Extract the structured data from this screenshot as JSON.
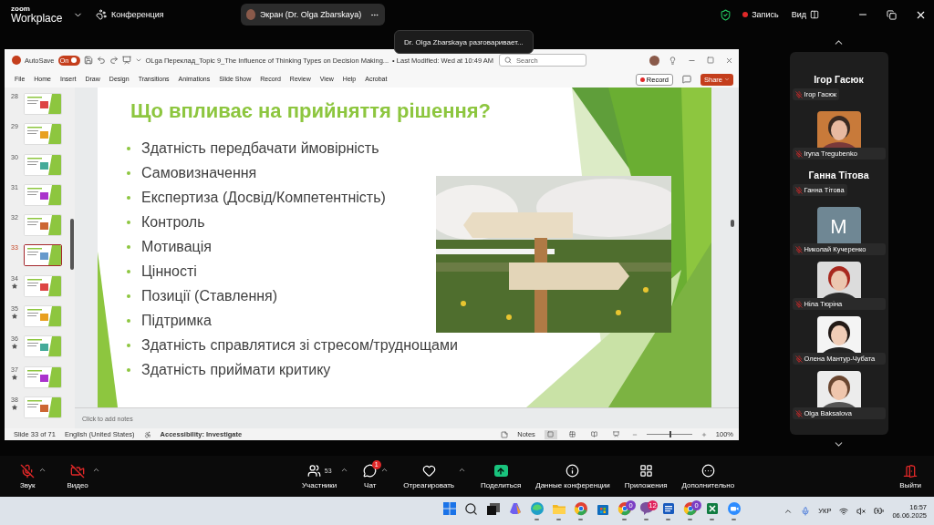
{
  "zoom_header": {
    "brand_top": "zoom",
    "brand_bottom": "Workplace",
    "meeting_label": "Конференция",
    "share_pill": "Экран (Dr. Olga Zbarskaya)",
    "recording": true,
    "record_label": "Запись",
    "view_label": "Вид"
  },
  "speaker_tooltip": "Dr. Olga Zbarskaya разговаривает...",
  "powerpoint": {
    "autosave_label": "AutoSave",
    "autosave_on": true,
    "autosave_state": "On",
    "file_title": "OLga Переклад_Topic 9_The Influence of Thinking Types on Decision Making...",
    "last_modified": "• Last Modified: Wed at 10:49 AM",
    "search_placeholder": "Search",
    "tabs": [
      {
        "label": "File",
        "selected": false
      },
      {
        "label": "Home",
        "selected": false
      },
      {
        "label": "Insert",
        "selected": false
      },
      {
        "label": "Draw",
        "selected": false
      },
      {
        "label": "Design",
        "selected": false
      },
      {
        "label": "Transitions",
        "selected": false
      },
      {
        "label": "Animations",
        "selected": false
      },
      {
        "label": "Slide Show",
        "selected": false
      },
      {
        "label": "Record",
        "selected": false
      },
      {
        "label": "Review",
        "selected": false
      },
      {
        "label": "View",
        "selected": false
      },
      {
        "label": "Help",
        "selected": false
      },
      {
        "label": "Acrobat",
        "selected": false
      }
    ],
    "record_button": "Record",
    "share_button": "Share",
    "thumbnails": [
      {
        "number": "28",
        "starred": false,
        "selected": false
      },
      {
        "number": "29",
        "starred": false,
        "selected": false
      },
      {
        "number": "30",
        "starred": false,
        "selected": false
      },
      {
        "number": "31",
        "starred": false,
        "selected": false
      },
      {
        "number": "32",
        "starred": false,
        "selected": false
      },
      {
        "number": "33",
        "starred": false,
        "selected": true
      },
      {
        "number": "34",
        "starred": true,
        "selected": false
      },
      {
        "number": "35",
        "starred": true,
        "selected": false
      },
      {
        "number": "36",
        "starred": true,
        "selected": false
      },
      {
        "number": "37",
        "starred": true,
        "selected": false
      },
      {
        "number": "38",
        "starred": true,
        "selected": false
      }
    ],
    "slide": {
      "title": "Що впливає на прийняття рішення?",
      "bullets": [
        "Здатність передбачати ймовірність",
        "Самовизначення",
        "Експертиза (Досвід/Компетентність)",
        "Контроль",
        "Мотивація",
        "Цінності",
        "Позиції (Ставлення)",
        "Підтримка",
        "Здатність справлятися зі стресом/труднощами",
        "Здатність приймати критику"
      ],
      "picture": {
        "kind": "picture"
      }
    },
    "notes_placeholder": "Click to add notes",
    "status_bar": {
      "slide_info": "Slide 33 of 71",
      "language": "English (United States)",
      "accessibility": "Accessibility: Investigate",
      "notes_label": "Notes",
      "views": [
        {
          "selected": true
        },
        {
          "selected": false
        },
        {
          "selected": false
        },
        {
          "selected": false
        }
      ],
      "zoom_slider": {
        "level": 0.5
      },
      "zoom_percent": "100%"
    }
  },
  "participants": [
    {
      "kind": "name_tile",
      "heading": "Ігор Гасюк",
      "name": "Ігор Гасюк",
      "muted": true
    },
    {
      "name": "Iryna Tregubenko",
      "muted": true
    },
    {
      "kind": "name_tile",
      "heading": "Ганна Тітова",
      "name": "Ганна Тітова",
      "muted": true
    },
    {
      "kind": "initial",
      "initial": "M",
      "name": "Николай Кучеренко",
      "muted": true
    },
    {
      "name": "Ніла Тюріна",
      "muted": true
    },
    {
      "name": "Олена Мантур-Чубата",
      "muted": true
    },
    {
      "name": "Olga Baksalova",
      "muted": true
    }
  ],
  "toolbar": {
    "left": [
      {
        "kind": "audio",
        "label": "Звук",
        "muted": true,
        "has_menu": true
      },
      {
        "kind": "video",
        "label": "Видео",
        "muted": true,
        "has_menu": true
      }
    ],
    "center": [
      {
        "kind": "participants",
        "label": "Участники",
        "count": "53",
        "has_menu": true
      },
      {
        "kind": "chat",
        "label": "Чат",
        "badge": "1",
        "has_menu": true
      },
      {
        "kind": "react",
        "label": "Отреагировать",
        "has_menu": true
      },
      {
        "kind": "share",
        "label": "Поделиться",
        "has_menu": false
      },
      {
        "kind": "info",
        "label": "Данные конференции",
        "has_menu": false
      },
      {
        "kind": "apps",
        "label": "Приложения",
        "has_menu": false
      },
      {
        "kind": "more",
        "label": "Дополнительно",
        "has_menu": false
      }
    ],
    "right": [
      {
        "kind": "leave",
        "label": "Выйти",
        "has_menu": false
      }
    ]
  },
  "taskbar": {
    "apps": [
      {
        "kind": "start",
        "running": false
      },
      {
        "kind": "search",
        "running": false
      },
      {
        "kind": "taskview",
        "running": false
      },
      {
        "kind": "copilot",
        "running": false
      },
      {
        "kind": "edge",
        "running": true
      },
      {
        "kind": "folder",
        "running": true
      },
      {
        "kind": "browser",
        "running": true
      },
      {
        "kind": "store",
        "running": false
      },
      {
        "kind": "browser",
        "badge": "0",
        "running": true
      },
      {
        "kind": "chat",
        "badge": "12",
        "running": true
      },
      {
        "kind": "word",
        "running": true
      },
      {
        "kind": "browser",
        "badge": "0",
        "running": true
      },
      {
        "kind": "spreadsheet",
        "running": true
      },
      {
        "kind": "video",
        "running": true
      }
    ],
    "tray": {
      "language": "УКР",
      "time": "16:57",
      "date": "06.06.2025"
    }
  }
}
